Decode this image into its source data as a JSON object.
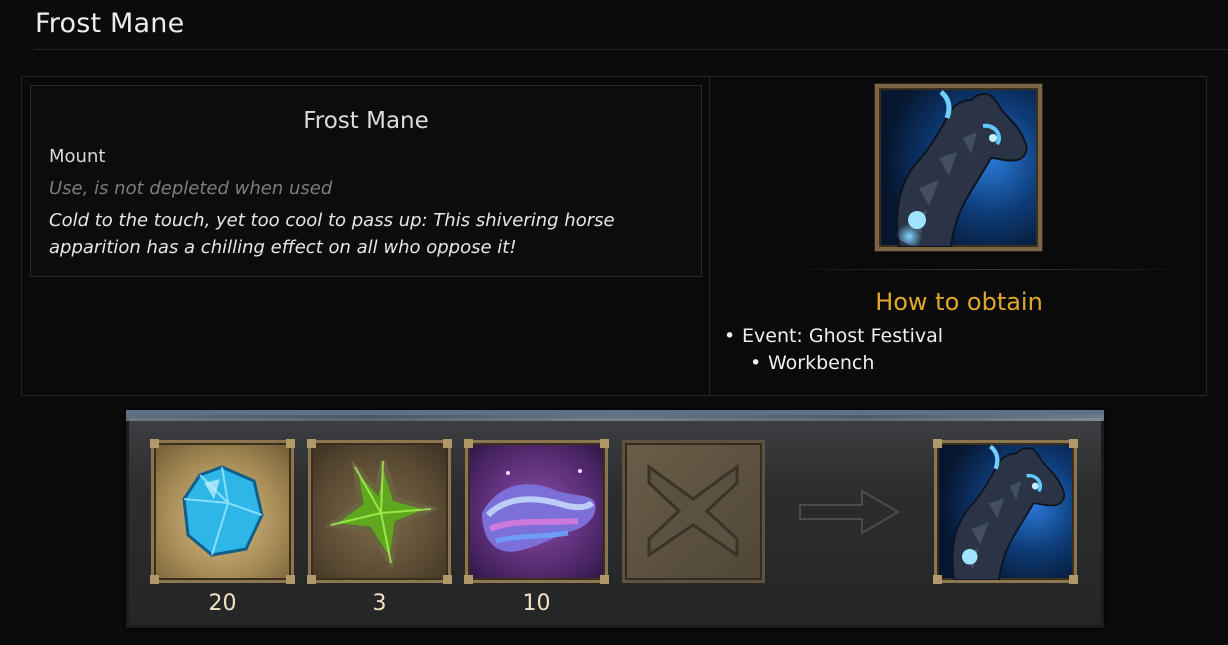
{
  "page": {
    "title": "Frost Mane"
  },
  "tooltip": {
    "name": "Frost Mane",
    "type": "Mount",
    "use_text": "Use, is not depleted when used",
    "description": "Cold to the touch, yet too cool to pass up: This shivering horse apparition has a chilling effect on all who oppose it!"
  },
  "obtain": {
    "heading": "How to obtain",
    "items": [
      {
        "label": "Event: Ghost Festival"
      },
      {
        "label": "Workbench"
      }
    ],
    "heading_color": "#e0a82a"
  },
  "recipe": {
    "ingredients": [
      {
        "icon": "blue-crystal-icon",
        "quantity": "20"
      },
      {
        "icon": "green-star-icon",
        "quantity": "3"
      },
      {
        "icon": "iridescent-cloth-icon",
        "quantity": "10"
      },
      {
        "icon": "empty-slot-icon",
        "quantity": ""
      }
    ],
    "result_icon": "frost-mane-icon",
    "arrow_icon": "right-arrow-icon"
  }
}
